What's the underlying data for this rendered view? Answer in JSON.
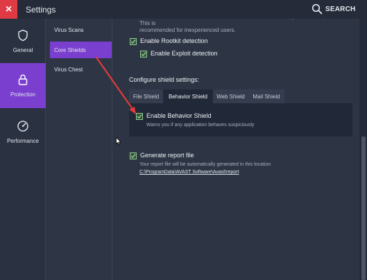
{
  "titlebar": {
    "close_glyph": "×",
    "title": "Settings",
    "search_label": "SEARCH"
  },
  "leftnav": {
    "items": [
      {
        "label": "General",
        "icon": "shield-icon"
      },
      {
        "label": "Protection",
        "icon": "lock-icon",
        "active": true
      },
      {
        "label": "Performance",
        "icon": "gauge-icon"
      }
    ]
  },
  "subnav": {
    "items": [
      {
        "label": "Virus Scans"
      },
      {
        "label": "Core Shields",
        "active": true
      },
      {
        "label": "Virus Chest"
      }
    ]
  },
  "main": {
    "intro_line1": "Use the Avast Hardened Mode to further lock down the security of this computer. This is",
    "intro_line2": "recommended for inexperienced users.",
    "rootkit_label": "Enable Rootkit detection",
    "exploit_label": "Enable Exploit detection",
    "configure_title": "Configure shield settings:",
    "tabs": [
      {
        "label": "File Shield"
      },
      {
        "label": "Behavior Shield",
        "active": true
      },
      {
        "label": "Web Shield"
      },
      {
        "label": "Mail Shield"
      }
    ],
    "behavior_label": "Enable Behavior Shield",
    "behavior_desc": "Warns you if any application behaves suspiciously",
    "report_label": "Generate report file",
    "report_desc": "Your report file will be automatically generated in this location",
    "report_path": "C:\\ProgramData\\AVAST Software\\Avast\\report"
  },
  "colors": {
    "accent": "#7b3fcf",
    "close": "#e03b45",
    "check": "#8ccf8c",
    "annotation_arrow": "#e23a3a"
  }
}
